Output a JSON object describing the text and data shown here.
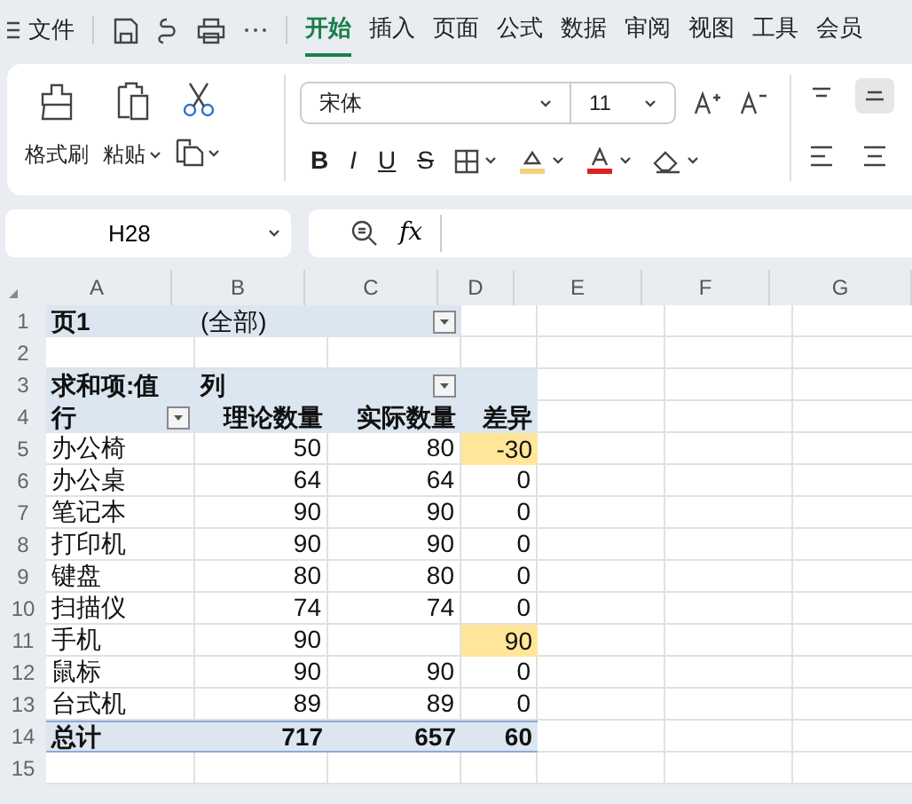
{
  "menu": {
    "file_label": "文件"
  },
  "tabs": [
    {
      "label": "开始",
      "selected": true
    },
    {
      "label": "插入",
      "selected": false
    },
    {
      "label": "页面",
      "selected": false
    },
    {
      "label": "公式",
      "selected": false
    },
    {
      "label": "数据",
      "selected": false
    },
    {
      "label": "审阅",
      "selected": false
    },
    {
      "label": "视图",
      "selected": false
    },
    {
      "label": "工具",
      "selected": false
    },
    {
      "label": "会员",
      "selected": false
    }
  ],
  "ribbon": {
    "format_painter": "格式刷",
    "paste": "粘贴",
    "font_name": "宋体",
    "font_size": "11",
    "bold": "B",
    "italic": "I",
    "underline": "U",
    "strike": "S"
  },
  "formula_bar": {
    "name_box": "H28",
    "fx": "fx"
  },
  "columns": [
    "A",
    "B",
    "C",
    "D",
    "E",
    "F",
    "G"
  ],
  "rows": [
    {
      "number": "1",
      "kind": "page-field",
      "cells": [
        {
          "text": "页1"
        },
        {
          "text": "(全部)"
        }
      ]
    },
    {
      "number": "2",
      "kind": "blank",
      "cells": []
    },
    {
      "number": "3",
      "kind": "header",
      "cells": [
        {
          "text": "求和项:值"
        },
        {
          "text": "列"
        }
      ]
    },
    {
      "number": "4",
      "kind": "column-header",
      "cells": [
        {
          "text": "行"
        },
        {
          "text": "理论数量"
        },
        {
          "text": "实际数量"
        },
        {
          "text": "差异"
        }
      ]
    },
    {
      "number": "5",
      "kind": "item",
      "cells": [
        {
          "text": "办公椅"
        },
        {
          "text": "50"
        },
        {
          "text": "80"
        },
        {
          "text": "-30",
          "highlighted": true
        }
      ]
    },
    {
      "number": "6",
      "kind": "item",
      "cells": [
        {
          "text": "办公桌"
        },
        {
          "text": "64"
        },
        {
          "text": "64"
        },
        {
          "text": "0"
        }
      ]
    },
    {
      "number": "7",
      "kind": "item",
      "cells": [
        {
          "text": "笔记本"
        },
        {
          "text": "90"
        },
        {
          "text": "90"
        },
        {
          "text": "0"
        }
      ]
    },
    {
      "number": "8",
      "kind": "item",
      "cells": [
        {
          "text": "打印机"
        },
        {
          "text": "90"
        },
        {
          "text": "90"
        },
        {
          "text": "0"
        }
      ]
    },
    {
      "number": "9",
      "kind": "item",
      "cells": [
        {
          "text": "键盘"
        },
        {
          "text": "80"
        },
        {
          "text": "80"
        },
        {
          "text": "0"
        }
      ]
    },
    {
      "number": "10",
      "kind": "item",
      "cells": [
        {
          "text": "扫描仪"
        },
        {
          "text": "74"
        },
        {
          "text": "74"
        },
        {
          "text": "0"
        }
      ]
    },
    {
      "number": "11",
      "kind": "item",
      "cells": [
        {
          "text": "手机"
        },
        {
          "text": "90"
        },
        {
          "text": ""
        },
        {
          "text": "90",
          "highlighted": true
        }
      ]
    },
    {
      "number": "12",
      "kind": "item",
      "cells": [
        {
          "text": "鼠标"
        },
        {
          "text": "90"
        },
        {
          "text": "90"
        },
        {
          "text": "0"
        }
      ]
    },
    {
      "number": "13",
      "kind": "item",
      "cells": [
        {
          "text": "台式机"
        },
        {
          "text": "89"
        },
        {
          "text": "89"
        },
        {
          "text": "0"
        }
      ]
    },
    {
      "number": "14",
      "kind": "total",
      "cells": [
        {
          "text": "总计"
        },
        {
          "text": "717"
        },
        {
          "text": "657"
        },
        {
          "text": "60"
        }
      ]
    },
    {
      "number": "15",
      "kind": "blank",
      "cells": []
    }
  ]
}
